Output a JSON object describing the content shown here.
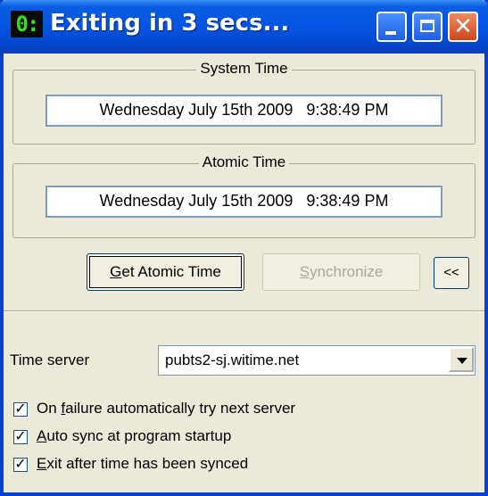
{
  "window": {
    "title": "Exiting in 3 secs...",
    "icon_text": "0:",
    "icon_name": "clock-app-icon"
  },
  "system_time": {
    "label": "System Time",
    "date": "Wednesday July 15th 2009",
    "time": "9:38:49 PM"
  },
  "atomic_time": {
    "label": "Atomic Time",
    "date": "Wednesday July 15th 2009",
    "time": "9:38:49 PM"
  },
  "buttons": {
    "get_atomic_time": {
      "mnemonic": "G",
      "rest": "et Atomic Time"
    },
    "synchronize": {
      "mnemonic": "S",
      "rest": "ynchronize"
    },
    "collapse": "<<"
  },
  "server": {
    "label": "Time server",
    "value": "pubts2-sj.witime.net"
  },
  "options": [
    {
      "before": "On ",
      "mnemonic": "f",
      "after": "ailure automatically try next server",
      "checked": true
    },
    {
      "before": "",
      "mnemonic": "A",
      "after": "uto sync at program startup",
      "checked": true
    },
    {
      "before": "",
      "mnemonic": "E",
      "after": "xit after time has been synced",
      "checked": true
    }
  ]
}
